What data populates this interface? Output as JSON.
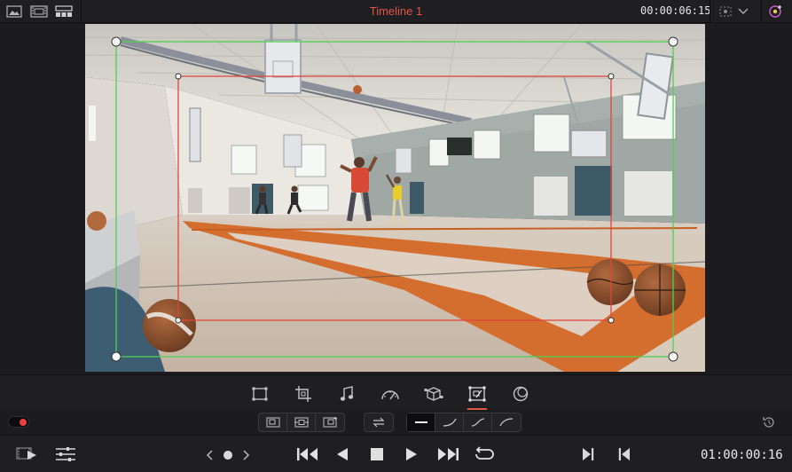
{
  "header": {
    "title": "Timeline 1",
    "timecode": "00:00:06:15"
  },
  "viewer": {
    "scene": "basketball-gym-video-frame"
  },
  "transform_tools": [
    {
      "id": "transform",
      "icon": "transform-icon"
    },
    {
      "id": "crop",
      "icon": "crop-icon"
    },
    {
      "id": "audio",
      "icon": "music-note-icon"
    },
    {
      "id": "speed",
      "icon": "speedometer-icon"
    },
    {
      "id": "stabilize",
      "icon": "cube-icon"
    },
    {
      "id": "dynamic-zoom",
      "icon": "dynamic-zoom-icon",
      "active": true
    },
    {
      "id": "composite",
      "icon": "composite-icon"
    }
  ],
  "transport": {
    "timecode": "01:00:00:16"
  },
  "colors": {
    "accent": "#e2554a",
    "start_box": "#4fd04f",
    "end_box": "#e0443c",
    "background": "#1c1c1e",
    "panel": "#1f1f22"
  }
}
